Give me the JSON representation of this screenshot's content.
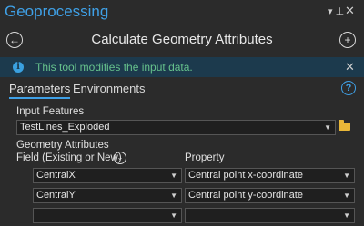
{
  "pane": {
    "title": "Geoprocessing",
    "pin_glyph": "▾ ⊥",
    "close_glyph": "✕"
  },
  "tool": {
    "title": "Calculate Geometry Attributes",
    "back_glyph": "←",
    "add_glyph": "+"
  },
  "banner": {
    "icon_glyph": "i",
    "message": "This tool modifies the input data.",
    "close_glyph": "✕"
  },
  "tabs": {
    "parameters": "Parameters",
    "environments": "Environments",
    "help_glyph": "?"
  },
  "form": {
    "input_features_label": "Input Features",
    "input_features_value": "TestLines_Exploded",
    "geometry_attributes_label": "Geometry Attributes",
    "field_col_label": "Field (Existing or New)",
    "property_col_label": "Property",
    "chevron_glyph": "⌄",
    "rows": [
      {
        "field": "CentralX",
        "property": "Central point x-coordinate"
      },
      {
        "field": "CentralY",
        "property": "Central point y-coordinate"
      },
      {
        "field": "",
        "property": ""
      }
    ]
  },
  "colors": {
    "background": "#2b2b2b",
    "accent": "#3fa0e6",
    "banner_bg": "#1c3a4d",
    "banner_text": "#66c28c",
    "folder": "#e9b738"
  },
  "icons": {
    "back": "back-arrow-icon",
    "add": "add-icon",
    "info": "info-icon",
    "help": "help-icon",
    "folder": "folder-icon",
    "dropdown": "chevron-down-icon"
  }
}
